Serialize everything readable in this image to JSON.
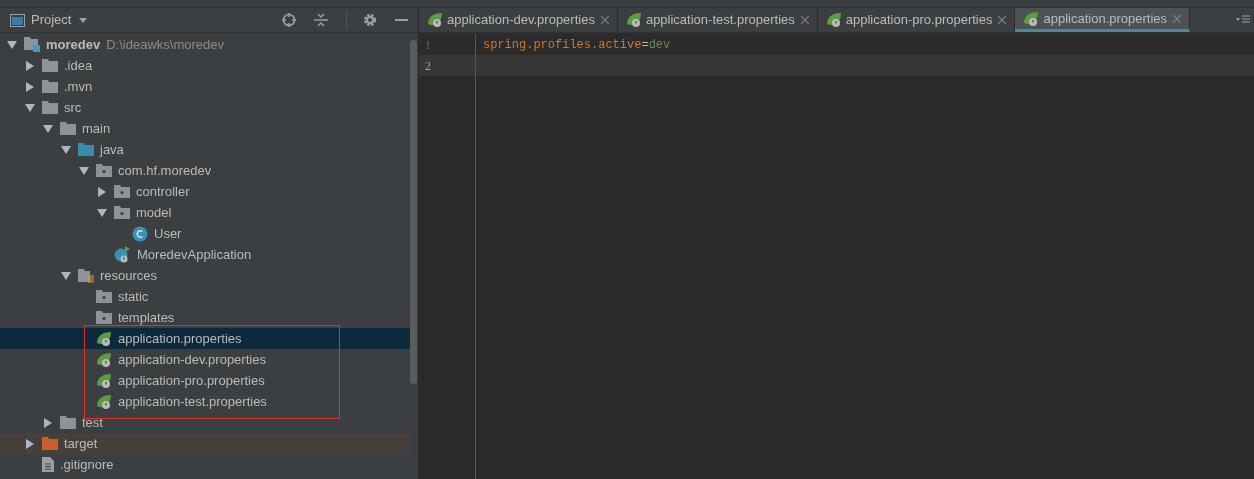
{
  "project_panel": {
    "title": "Project",
    "tree": [
      {
        "label": "moredev",
        "path": "D:\\ideawks\\moredev",
        "kind": "project",
        "expanded": true,
        "selected": false,
        "children": [
          {
            "label": ".idea",
            "kind": "folder",
            "expanded": false,
            "selected": false
          },
          {
            "label": ".mvn",
            "kind": "folder",
            "expanded": false,
            "selected": false
          },
          {
            "label": "src",
            "kind": "folder",
            "expanded": true,
            "selected": false,
            "children": [
              {
                "label": "main",
                "kind": "folder",
                "expanded": true,
                "selected": false,
                "children": [
                  {
                    "label": "java",
                    "kind": "source-folder",
                    "expanded": true,
                    "selected": false,
                    "children": [
                      {
                        "label": "com.hf.moredev",
                        "kind": "package",
                        "expanded": true,
                        "selected": false,
                        "children": [
                          {
                            "label": "controller",
                            "kind": "package",
                            "expanded": false,
                            "selected": false
                          },
                          {
                            "label": "model",
                            "kind": "package",
                            "expanded": true,
                            "selected": false,
                            "children": [
                              {
                                "label": "User",
                                "kind": "class",
                                "selected": false
                              }
                            ]
                          },
                          {
                            "label": "MoredevApplication",
                            "kind": "app-class",
                            "selected": false
                          }
                        ]
                      }
                    ]
                  },
                  {
                    "label": "resources",
                    "kind": "resources-folder",
                    "expanded": true,
                    "selected": false,
                    "children": [
                      {
                        "label": "static",
                        "kind": "package",
                        "selected": false
                      },
                      {
                        "label": "templates",
                        "kind": "package",
                        "selected": false
                      },
                      {
                        "label": "application.properties",
                        "kind": "spring-file",
                        "selected": true,
                        "framed": true
                      },
                      {
                        "label": "application-dev.properties",
                        "kind": "spring-file",
                        "selected": false,
                        "framed": true
                      },
                      {
                        "label": "application-pro.properties",
                        "kind": "spring-file",
                        "selected": false,
                        "framed": true
                      },
                      {
                        "label": "application-test.properties",
                        "kind": "spring-file",
                        "selected": false,
                        "framed": true
                      }
                    ]
                  }
                ]
              },
              {
                "label": "test",
                "kind": "folder",
                "expanded": false,
                "selected": false
              }
            ]
          },
          {
            "label": "target",
            "kind": "excluded-folder",
            "expanded": false,
            "selected": false
          },
          {
            "label": ".gitignore",
            "kind": "file",
            "selected": false
          }
        ]
      }
    ]
  },
  "editor": {
    "tabs": [
      {
        "label": "application-dev.properties",
        "selected": false
      },
      {
        "label": "application-test.properties",
        "selected": false
      },
      {
        "label": "application-pro.properties",
        "selected": false
      },
      {
        "label": "application.properties",
        "selected": true
      }
    ],
    "lines": [
      {
        "number": "1",
        "key": "spring.profiles.active",
        "separator": "=",
        "value": "dev",
        "current": false
      },
      {
        "number": "2",
        "current": true
      }
    ]
  }
}
